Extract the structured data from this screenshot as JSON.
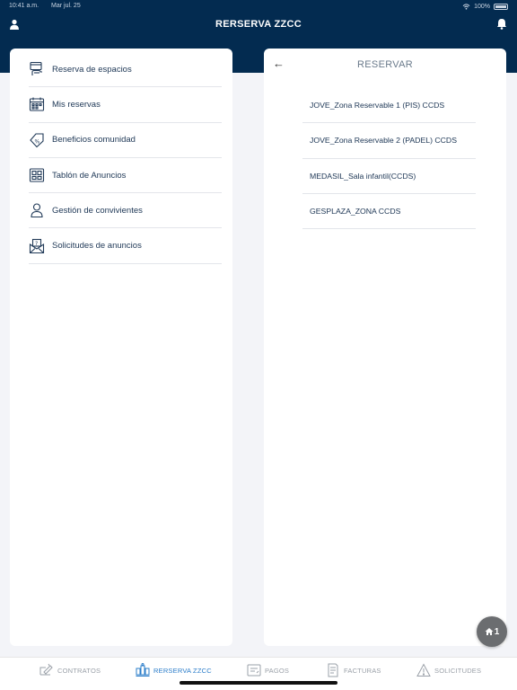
{
  "status_bar": {
    "time": "10:41 a.m.",
    "date": "Mar jul. 25",
    "battery": "100%"
  },
  "header": {
    "title": "RERSERVA ZZCC"
  },
  "menu": {
    "items": [
      {
        "label": "Reserva de espacios",
        "icon": "calendar-hand-icon"
      },
      {
        "label": "Mis reservas",
        "icon": "calendar-grid-icon"
      },
      {
        "label": "Beneficios comunidad",
        "icon": "discount-tag-icon"
      },
      {
        "label": "Tablón de Anuncios",
        "icon": "board-icon"
      },
      {
        "label": "Gestión de convivientes",
        "icon": "person-icon"
      },
      {
        "label": "Solicitudes de anuncios",
        "icon": "mail-question-icon"
      }
    ]
  },
  "reservar": {
    "back": "←",
    "title": "RESERVAR",
    "items": [
      "JOVE_Zona Reservable 1 (PIS) CCDS",
      "JOVE_Zona Reservable 2 (PADEL) CCDS",
      "MEDASIL_Sala infantil(CCDS)",
      "GESPLAZA_ZONA CCDS"
    ]
  },
  "fab": {
    "count": "1"
  },
  "tabs": [
    {
      "label": "CONTRATOS",
      "active": false
    },
    {
      "label": "RERSERVA ZZCC",
      "active": true
    },
    {
      "label": "PAGOS",
      "active": false
    },
    {
      "label": "FACTURAS",
      "active": false
    },
    {
      "label": "SOLICITUDES",
      "active": false
    }
  ],
  "colors": {
    "header": "#032b50",
    "active_tab": "#2a7cc9",
    "fab": "#6b6d70"
  }
}
